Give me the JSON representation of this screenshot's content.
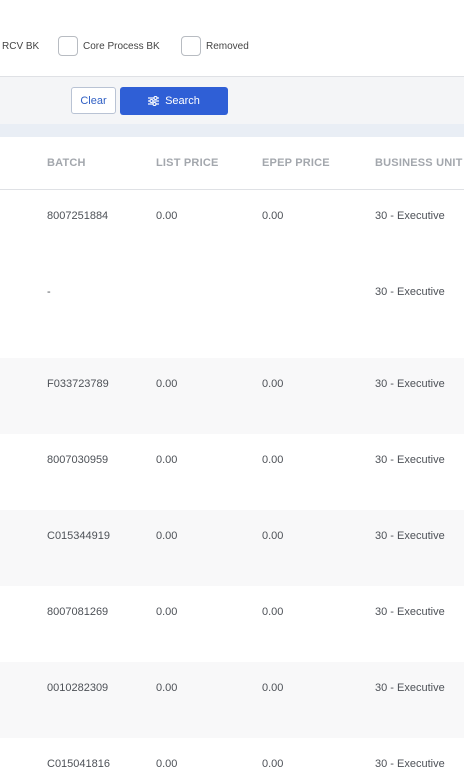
{
  "filters": {
    "rcv_bk_label": "RCV BK",
    "core_process_bk_label": "Core Process BK",
    "removed_label": "Removed"
  },
  "actions": {
    "clear_label": "Clear",
    "search_label": "Search"
  },
  "table": {
    "headers": {
      "batch": "BATCH",
      "list_price": "LIST PRICE",
      "epep_price": "EPEP PRICE",
      "business_unit": "BUSINESS UNIT"
    },
    "rows": [
      {
        "batch": "8007251884",
        "list_price": "0.00",
        "epep_price": "0.00",
        "business_unit": "30 - Executive"
      },
      {
        "batch": "-",
        "list_price": "",
        "epep_price": "",
        "business_unit": "30 - Executive"
      },
      {
        "batch": "F033723789",
        "list_price": "0.00",
        "epep_price": "0.00",
        "business_unit": "30 - Executive"
      },
      {
        "batch": "8007030959",
        "list_price": "0.00",
        "epep_price": "0.00",
        "business_unit": "30 - Executive"
      },
      {
        "batch": "C015344919",
        "list_price": "0.00",
        "epep_price": "0.00",
        "business_unit": "30 - Executive"
      },
      {
        "batch": "8007081269",
        "list_price": "0.00",
        "epep_price": "0.00",
        "business_unit": "30 - Executive"
      },
      {
        "batch": "0010282309",
        "list_price": "0.00",
        "epep_price": "0.00",
        "business_unit": "30 - Executive"
      },
      {
        "batch": "C015041816",
        "list_price": "0.00",
        "epep_price": "0.00",
        "business_unit": "30 - Executive"
      }
    ]
  }
}
